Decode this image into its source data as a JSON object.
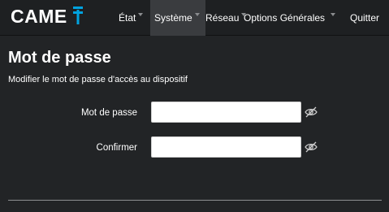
{
  "brand": {
    "name": "CAME"
  },
  "nav": {
    "items": [
      {
        "label": "État",
        "has_dropdown": true,
        "active": false
      },
      {
        "label": "Système",
        "has_dropdown": true,
        "active": true
      },
      {
        "label": "Réseau",
        "has_dropdown": true,
        "active": false
      },
      {
        "label": "Options Générales",
        "has_dropdown": true,
        "active": false
      },
      {
        "label": "Quitter",
        "has_dropdown": false,
        "active": false
      }
    ]
  },
  "page": {
    "title": "Mot de passe",
    "subtitle": "Modifier le mot de passe d'accès au dispositif"
  },
  "form": {
    "password": {
      "label": "Mot de passe",
      "value": "",
      "icon": "eye-slash-icon"
    },
    "confirm": {
      "label": "Confirmer",
      "value": "",
      "icon": "eye-slash-icon"
    }
  },
  "colors": {
    "background": "#222426",
    "navbar": "#1e2022",
    "active_nav": "#3a3c3f",
    "logo_accent": "#00a3e0"
  }
}
